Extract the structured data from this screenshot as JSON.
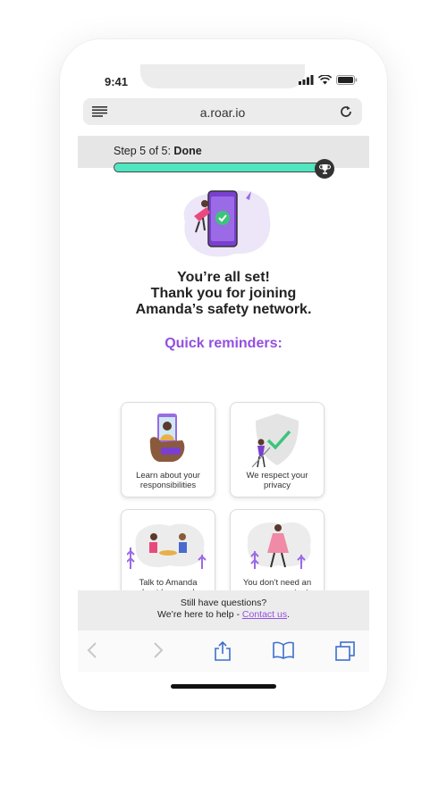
{
  "status_bar": {
    "time": "9:41",
    "icons": [
      "signal-icon",
      "wifi-icon",
      "battery-icon"
    ]
  },
  "browser": {
    "url": "a.roar.io",
    "menu_icon": "menu-icon",
    "reload_icon": "reload-icon"
  },
  "progress": {
    "step_prefix": "Step 5 of 5:",
    "step_name": "Done",
    "percent": 100,
    "trophy_icon": "trophy-icon"
  },
  "heading": {
    "line1": "You’re all set!",
    "line2": "Thank you for joining",
    "line3": "Amanda’s safety network."
  },
  "reminders": {
    "title": "Quick reminders:",
    "cards": [
      {
        "line1": "Learn about your",
        "line2": "responsibilities"
      },
      {
        "line1": "We respect your",
        "line2": "privacy"
      },
      {
        "line1": "Talk to Amanda",
        "line2": "about her needs"
      },
      {
        "line1": "You don’t need an",
        "line2": "app as a contact"
      }
    ]
  },
  "footer": {
    "line1": "Still have questions?",
    "line2_prefix": "We’re here to help - ",
    "link": "Contact us",
    "line2_suffix": "."
  },
  "toolbar": {
    "icons": [
      "back-icon",
      "forward-icon",
      "share-icon",
      "bookmarks-icon",
      "tabs-icon"
    ]
  },
  "colors": {
    "accent": "#9450e0",
    "progress": "#4fe6c0",
    "success": "#3cc47c"
  }
}
